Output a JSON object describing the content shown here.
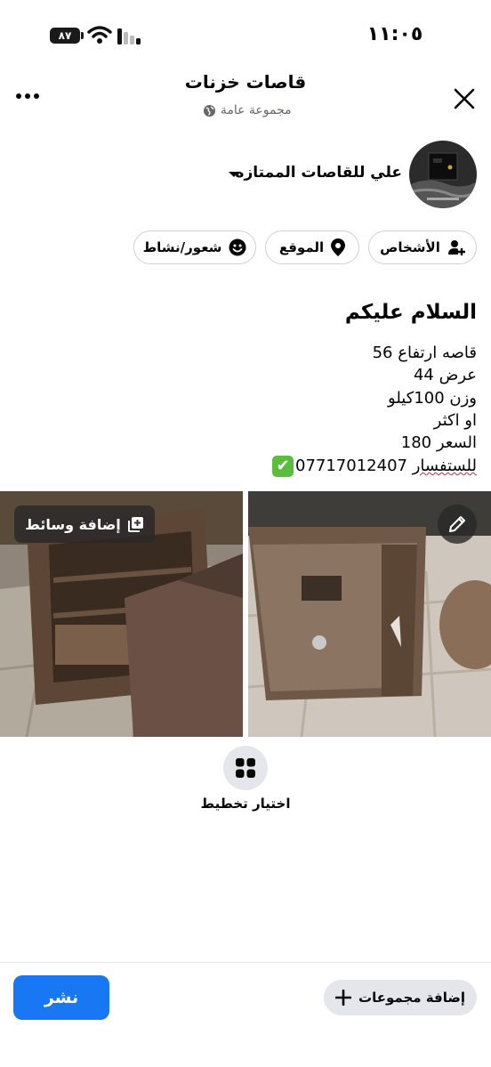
{
  "status_bar": {
    "time": "١١:٠٥",
    "battery": "٨٧"
  },
  "header": {
    "title": "قاصات خزنات",
    "subtitle": "مجموعة عامة",
    "close_icon": "close-icon",
    "more_icon": "more-icon"
  },
  "author": {
    "name": "علي للقاصات الممتازه"
  },
  "chips": [
    {
      "label": "الأشخاص",
      "icon": "person-add-icon"
    },
    {
      "label": "الموقع",
      "icon": "location-pin-icon"
    },
    {
      "label": "شعور/نشاط",
      "icon": "smiley-icon"
    }
  ],
  "post": {
    "heading": "السلام عليكم",
    "lines": [
      "قاصه ارتفاع 56",
      "عرض 44",
      "وزن 100كيلو",
      "او اكثر",
      "السعر 180"
    ],
    "contact_word": "للستفسار",
    "contact_number": "07717012407",
    "check_emoji": "✔"
  },
  "media": {
    "add_media_label": "إضافة وسائط",
    "edit_icon": "pencil-icon"
  },
  "layout": {
    "label": "اختيار تخطيط"
  },
  "footer": {
    "publish_label": "نشر",
    "add_groups_label": "إضافة مجموعات"
  },
  "colors": {
    "primary": "#1877f2",
    "chip_border": "#ced0d4",
    "secondary_text": "#65676b"
  }
}
